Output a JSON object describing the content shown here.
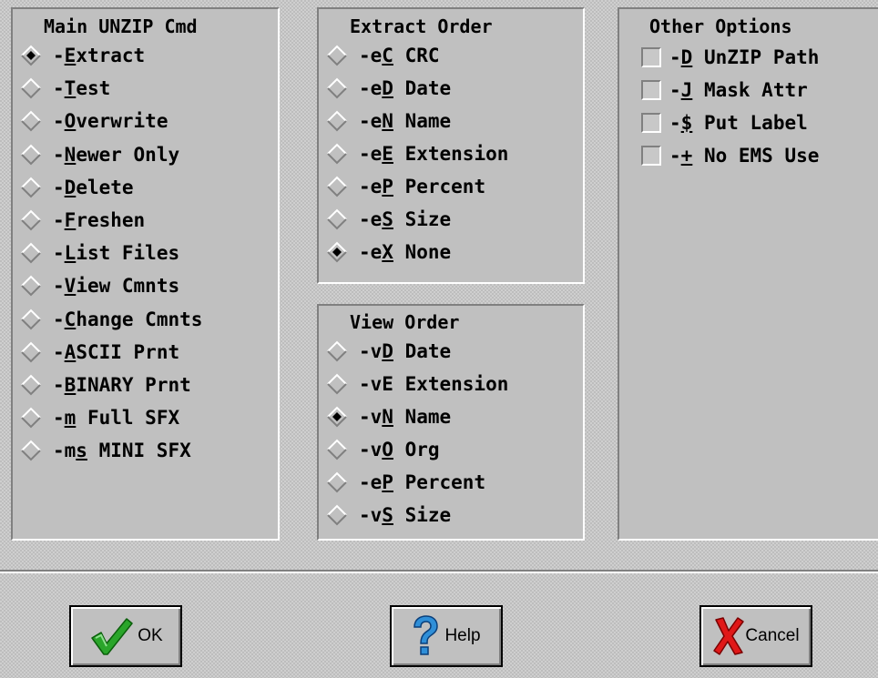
{
  "main_cmd": {
    "title": "Main UNZIP Cmd",
    "items": [
      {
        "pre": "-",
        "u": "E",
        "post": "xtract",
        "selected": true
      },
      {
        "pre": "-",
        "u": "T",
        "post": "est",
        "selected": false
      },
      {
        "pre": "-",
        "u": "O",
        "post": "verwrite",
        "selected": false
      },
      {
        "pre": "-",
        "u": "N",
        "post": "ewer Only",
        "selected": false
      },
      {
        "pre": "-",
        "u": "D",
        "post": "elete",
        "selected": false
      },
      {
        "pre": "-",
        "u": "F",
        "post": "reshen",
        "selected": false
      },
      {
        "pre": "-",
        "u": "L",
        "post": "ist Files",
        "selected": false
      },
      {
        "pre": "-",
        "u": "V",
        "post": "iew Cmnts",
        "selected": false
      },
      {
        "pre": "-",
        "u": "C",
        "post": "hange Cmnts",
        "selected": false
      },
      {
        "pre": "-",
        "u": "A",
        "post": "SCII Prnt",
        "selected": false
      },
      {
        "pre": "-",
        "u": "B",
        "post": "INARY Prnt",
        "selected": false
      },
      {
        "pre": "-",
        "u": "m",
        "post": " Full SFX",
        "selected": false
      },
      {
        "pre": "-m",
        "u": "s",
        "post": " MINI SFX",
        "selected": false
      }
    ]
  },
  "extract_order": {
    "title": "Extract Order",
    "items": [
      {
        "pre": "-e",
        "u": "C",
        "post": " CRC",
        "selected": false
      },
      {
        "pre": "-e",
        "u": "D",
        "post": " Date",
        "selected": false
      },
      {
        "pre": "-e",
        "u": "N",
        "post": " Name",
        "selected": false
      },
      {
        "pre": "-e",
        "u": "E",
        "post": " Extension",
        "selected": false
      },
      {
        "pre": "-e",
        "u": "P",
        "post": " Percent",
        "selected": false
      },
      {
        "pre": "-e",
        "u": "S",
        "post": " Size",
        "selected": false
      },
      {
        "pre": "-e",
        "u": "X",
        "post": " None",
        "selected": true
      }
    ]
  },
  "view_order": {
    "title": "View Order",
    "items": [
      {
        "pre": "-v",
        "u": "D",
        "post": " Date",
        "selected": false
      },
      {
        "pre": "-vE Extension",
        "u": "",
        "post": "",
        "selected": false
      },
      {
        "pre": "-v",
        "u": "N",
        "post": " Name",
        "selected": true
      },
      {
        "pre": "-v",
        "u": "O",
        "post": " Org",
        "selected": false
      },
      {
        "pre": "-e",
        "u": "P",
        "post": " Percent",
        "selected": false
      },
      {
        "pre": "-v",
        "u": "S",
        "post": " Size",
        "selected": false
      }
    ]
  },
  "other_options": {
    "title": "Other Options",
    "items": [
      {
        "pre": "-",
        "u": "D",
        "post": " UnZIP Path",
        "checked": false
      },
      {
        "pre": "-",
        "u": "J",
        "post": " Mask Attr",
        "checked": false
      },
      {
        "pre": "-",
        "u": "$",
        "post": " Put Label",
        "checked": false
      },
      {
        "pre": "-",
        "u": "+",
        "post": " No EMS Use",
        "checked": false
      }
    ]
  },
  "buttons": {
    "ok": {
      "label": "OK",
      "icon": "checkmark-icon",
      "icon_color": "#2aa52a"
    },
    "help": {
      "label": "Help",
      "icon": "question-mark-icon",
      "icon_color": "#2f8fd8"
    },
    "cancel": {
      "label": "Cancel",
      "icon": "x-mark-icon",
      "icon_color": "#e01818"
    }
  }
}
